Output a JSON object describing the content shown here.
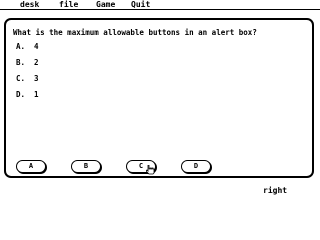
{
  "menubar": {
    "items": [
      {
        "label": "desk"
      },
      {
        "label": "file"
      },
      {
        "label": "Game"
      },
      {
        "label": "Quit"
      }
    ]
  },
  "dialog": {
    "question": "What is the maximum allowable buttons in an alert box?",
    "options": [
      {
        "letter": "A.",
        "text": "4"
      },
      {
        "letter": "B.",
        "text": "2"
      },
      {
        "letter": "C.",
        "text": "3"
      },
      {
        "letter": "D.",
        "text": "1"
      }
    ],
    "buttons": [
      {
        "label": "A"
      },
      {
        "label": "B"
      },
      {
        "label": "C"
      },
      {
        "label": "D"
      }
    ]
  },
  "status": {
    "result": "right"
  },
  "cursor": {
    "icon": "pointing-hand-icon"
  },
  "colors": {
    "foreground": "#000000",
    "background": "#ffffff"
  }
}
